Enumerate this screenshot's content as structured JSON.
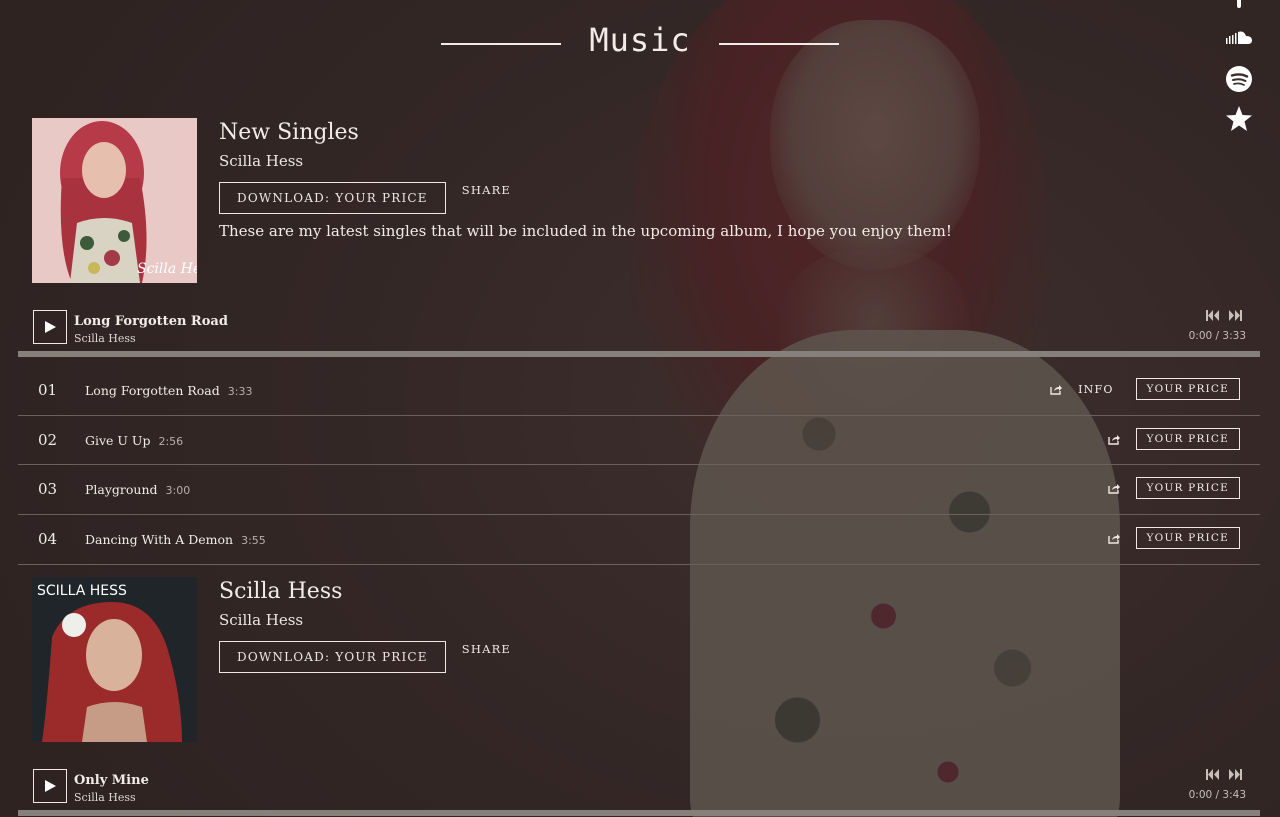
{
  "header": {
    "title": "Music"
  },
  "social": [
    {
      "name": "facebook-icon"
    },
    {
      "name": "soundcloud-icon"
    },
    {
      "name": "spotify-icon"
    },
    {
      "name": "star-icon"
    }
  ],
  "albums": [
    {
      "title": "New Singles",
      "artist": "Scilla Hess",
      "download_label": "DOWNLOAD: YOUR PRICE",
      "share_label": "SHARE",
      "description": "These are my latest singles that will be included in the upcoming album, I hope you enjoy them!",
      "cover_signature": "Scilla Hess",
      "player": {
        "title": "Long Forgotten Road",
        "artist": "Scilla Hess",
        "time": "0:00 / 3:33",
        "progress": 0
      },
      "tracks": [
        {
          "num": "01",
          "name": "Long Forgotten Road",
          "duration": "3:33",
          "info": "INFO",
          "price": "YOUR PRICE"
        },
        {
          "num": "02",
          "name": "Give U Up",
          "duration": "2:56",
          "price": "YOUR PRICE"
        },
        {
          "num": "03",
          "name": "Playground",
          "duration": "3:00",
          "price": "YOUR PRICE"
        },
        {
          "num": "04",
          "name": "Dancing With A Demon",
          "duration": "3:55",
          "price": "YOUR PRICE"
        }
      ]
    },
    {
      "title": "Scilla Hess",
      "artist": "Scilla Hess",
      "download_label": "DOWNLOAD: YOUR PRICE",
      "share_label": "SHARE",
      "cover_text": "SCILLA HESS",
      "player": {
        "title": "Only Mine",
        "artist": "Scilla Hess",
        "time": "0:00 / 3:43",
        "progress": 0
      }
    }
  ]
}
